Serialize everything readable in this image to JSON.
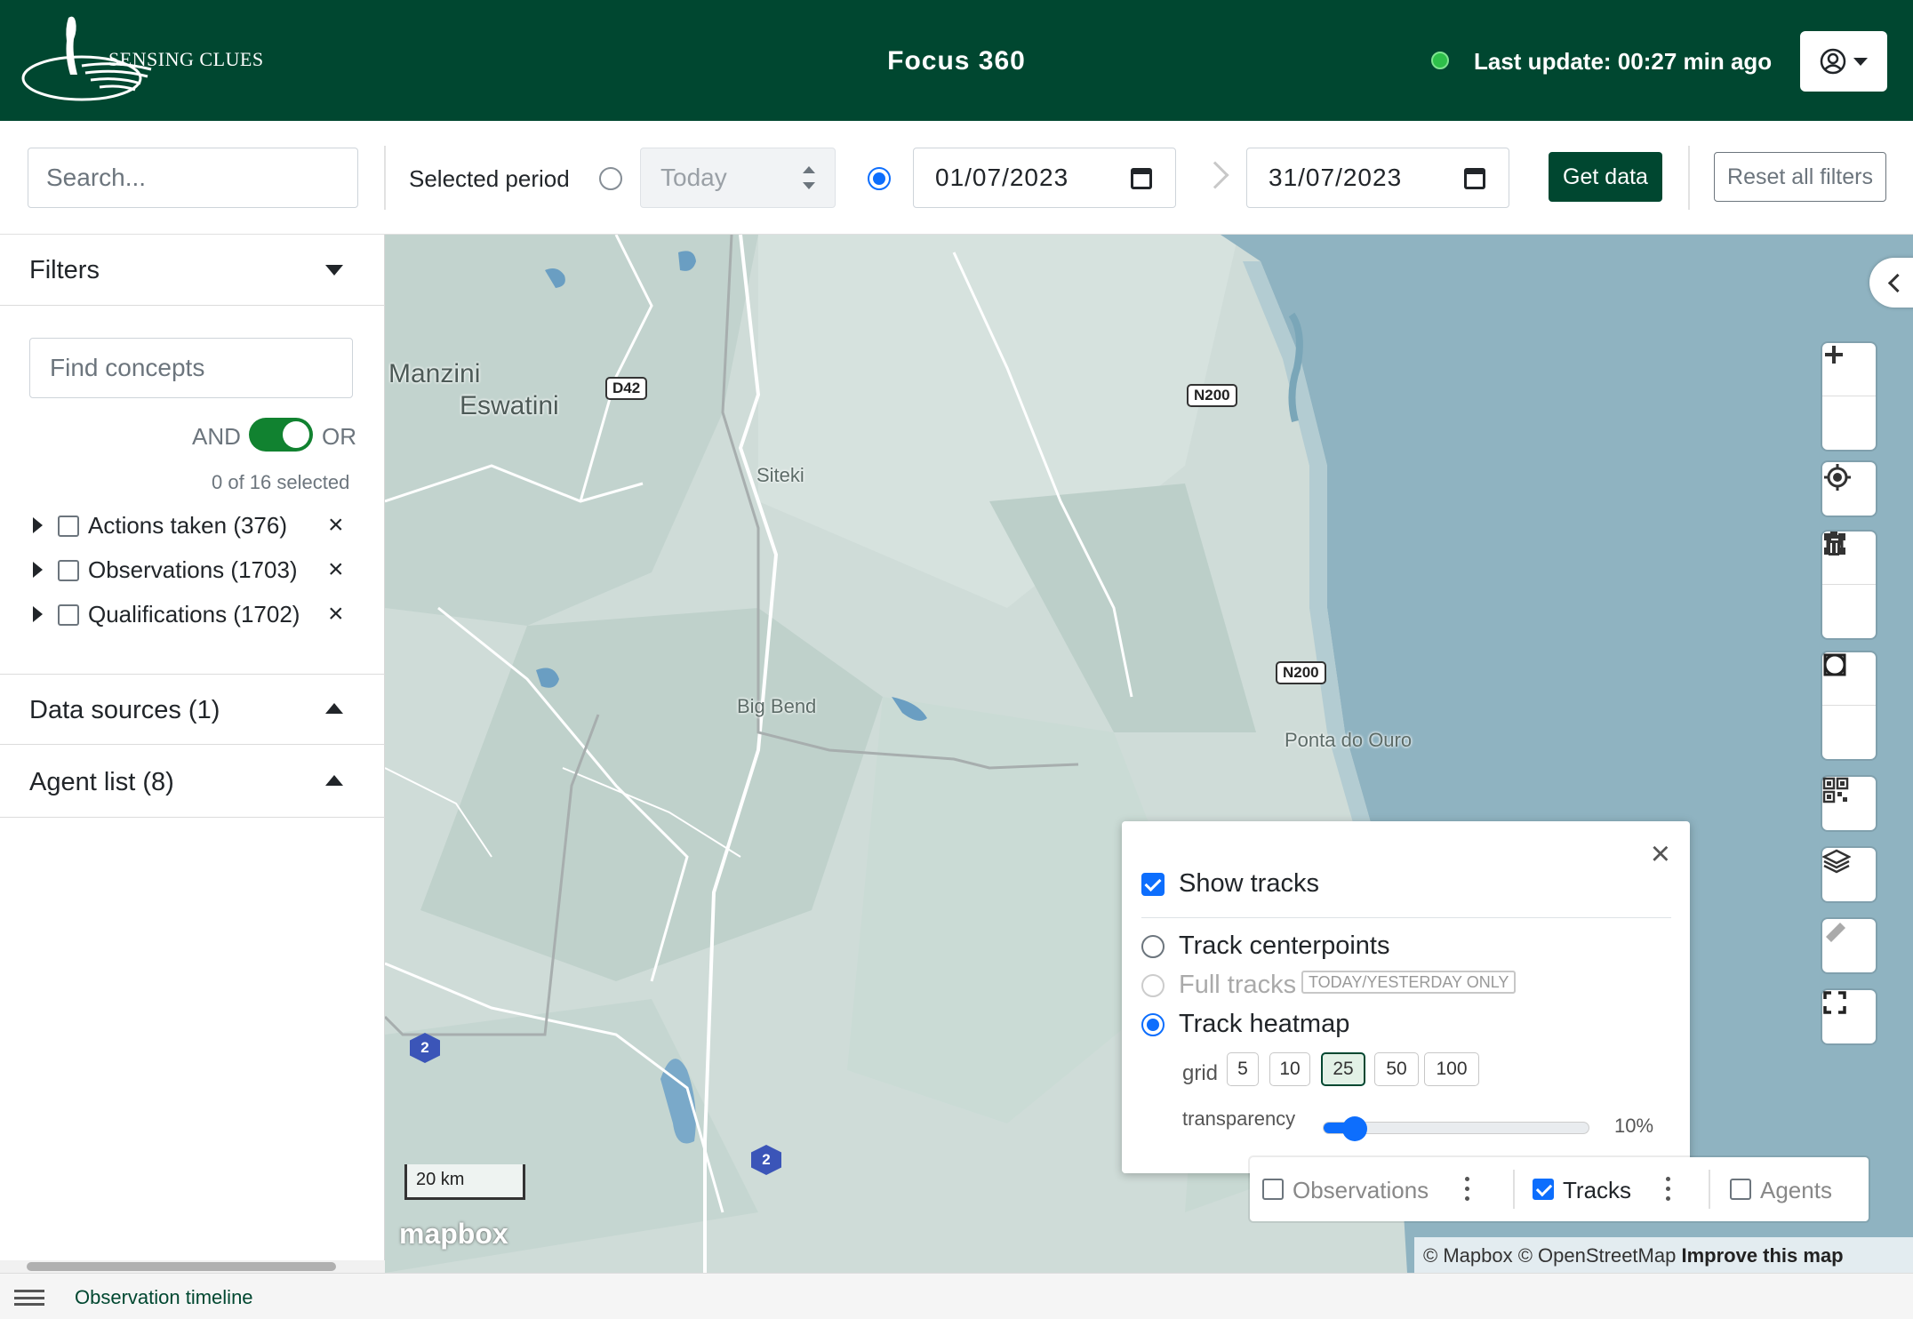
{
  "header": {
    "logo_text": "SENSING CLUES",
    "app_title": "Focus 360",
    "last_update": "Last update: 00:27 min ago",
    "status_color": "#2ec04a",
    "brand_color": "#004730",
    "user_menu_icon": "user-circle-icon"
  },
  "toolbar": {
    "search_placeholder": "Search...",
    "period_label": "Selected period",
    "period_select_value": "Today",
    "date_from": "01/07/2023",
    "date_to": "31/07/2023",
    "get_data_label": "Get data",
    "reset_label": "Reset all filters",
    "preset_radio_checked": false,
    "range_radio_checked": true
  },
  "sidebar": {
    "filters_title": "Filters",
    "find_concepts_placeholder": "Find concepts",
    "and_label": "AND",
    "or_label": "OR",
    "selected_count": "0 of 16 selected",
    "concepts": [
      {
        "label": "Actions taken (376)",
        "checked": false
      },
      {
        "label": "Observations (1703)",
        "checked": false
      },
      {
        "label": "Qualifications (1702)",
        "checked": false
      }
    ],
    "data_sources_title": "Data sources (1)",
    "agent_list_title": "Agent list (8)"
  },
  "map": {
    "labels": {
      "manzini": "Manzini",
      "eswatini": "Eswatini",
      "siteki": "Siteki",
      "big_bend": "Big Bend",
      "ponta": "Ponta do Ouro"
    },
    "shields": {
      "d42": "D42",
      "n200a": "N200",
      "n200b": "N200"
    },
    "route_badges": {
      "a": "2",
      "b": "2"
    },
    "scale": "20 km",
    "mapbox_logo": "mapbox",
    "attribution_1": "© Mapbox © OpenStreetMap",
    "attribution_2": "Improve this map"
  },
  "tracks_popup": {
    "show_tracks_label": "Show tracks",
    "show_tracks_checked": true,
    "centerpoints_label": "Track centerpoints",
    "full_tracks_label": "Full tracks",
    "full_tracks_badge": "TODAY/YESTERDAY ONLY",
    "heatmap_label": "Track heatmap",
    "selected_mode": "heatmap",
    "grid_label": "grid",
    "grid_options": [
      "5",
      "10",
      "25",
      "50",
      "100"
    ],
    "grid_selected": "25",
    "transparency_label": "transparency",
    "transparency_value": "10%",
    "transparency_fraction": 0.1
  },
  "layers_bar": {
    "observations_label": "Observations",
    "observations_checked": false,
    "tracks_label": "Tracks",
    "tracks_checked": true,
    "agents_label": "Agents",
    "agents_checked": false
  },
  "footer": {
    "timeline_label": "Observation timeline"
  }
}
